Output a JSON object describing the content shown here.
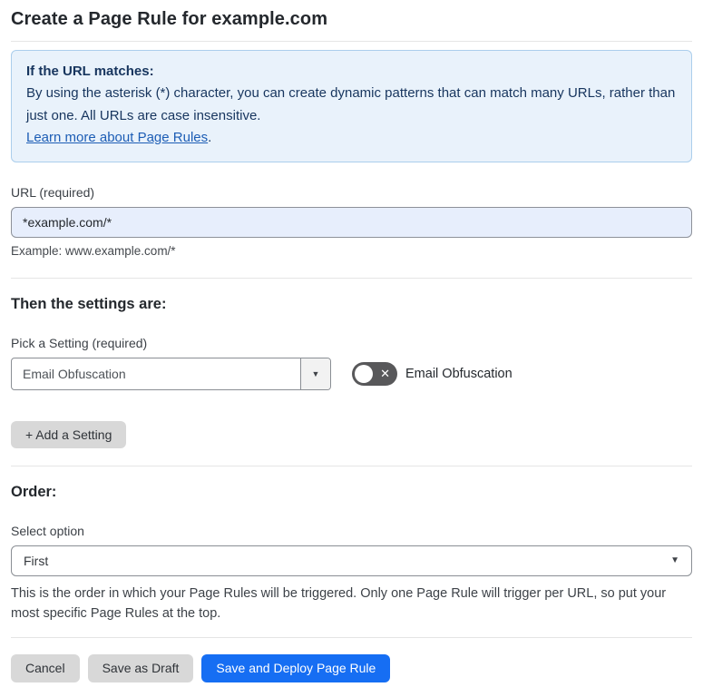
{
  "page": {
    "title": "Create a Page Rule for example.com"
  },
  "info_box": {
    "heading": "If the URL matches:",
    "body": "By using the asterisk (*) character, you can create dynamic patterns that can match many URLs, rather than just one. All URLs are case insensitive.",
    "link": "Learn more about Page Rules",
    "link_suffix": "."
  },
  "url_field": {
    "label": "URL (required)",
    "value": "*example.com/*",
    "helper": "Example: www.example.com/*"
  },
  "settings_section": {
    "heading": "Then the settings are:",
    "picker_label": "Pick a Setting (required)",
    "selected_setting": "Email Obfuscation",
    "toggle_state": "off",
    "toggle_x": "✕",
    "toggle_label": "Email Obfuscation",
    "add_setting_button": "+ Add a Setting",
    "dropdown_arrow": "▼"
  },
  "order_section": {
    "heading": "Order:",
    "select_label": "Select option",
    "selected_option": "First",
    "dropdown_arrow": "▼",
    "description": "This is the order in which your Page Rules will be triggered. Only one Page Rule will trigger per URL, so put your most specific Page Rules at the top."
  },
  "footer": {
    "cancel_label": "Cancel",
    "save_draft_label": "Save as Draft",
    "save_deploy_label": "Save and Deploy Page Rule"
  },
  "colors": {
    "accent_blue": "#166ef3",
    "info_background": "#e9f2fb",
    "info_border": "#abceec",
    "info_text": "#17355e",
    "link_blue": "#1c5db5",
    "input_background": "#e7eefc",
    "toggle_off_background": "#58585a",
    "gray_button": "#d8d8d8"
  }
}
